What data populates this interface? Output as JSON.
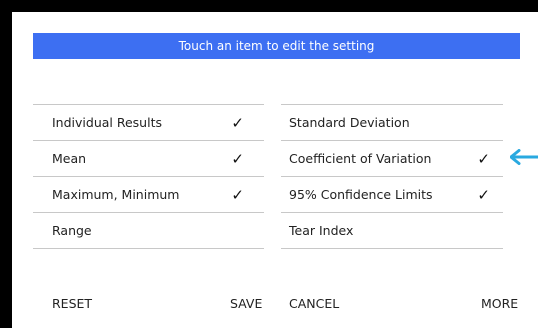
{
  "banner": {
    "text": "Touch an item to edit the setting"
  },
  "left_list": [
    {
      "label": "Individual Results",
      "checked": true
    },
    {
      "label": "Mean",
      "checked": true
    },
    {
      "label": "Maximum, Minimum",
      "checked": true
    },
    {
      "label": "Range",
      "checked": false
    }
  ],
  "right_list": [
    {
      "label": "Standard Deviation",
      "checked": false
    },
    {
      "label": "Coefficient of Variation",
      "checked": true
    },
    {
      "label": "95% Confidence Limits",
      "checked": true
    },
    {
      "label": "Tear Index",
      "checked": false
    }
  ],
  "check_glyph": "✓",
  "footer": {
    "reset": "RESET",
    "save": "SAVE",
    "cancel": "CANCEL",
    "more": "MORE"
  },
  "colors": {
    "banner_bg": "#3d6ff2",
    "arrow": "#29a9e0"
  },
  "icons": {
    "pointer_arrow": "left-arrow-icon"
  }
}
